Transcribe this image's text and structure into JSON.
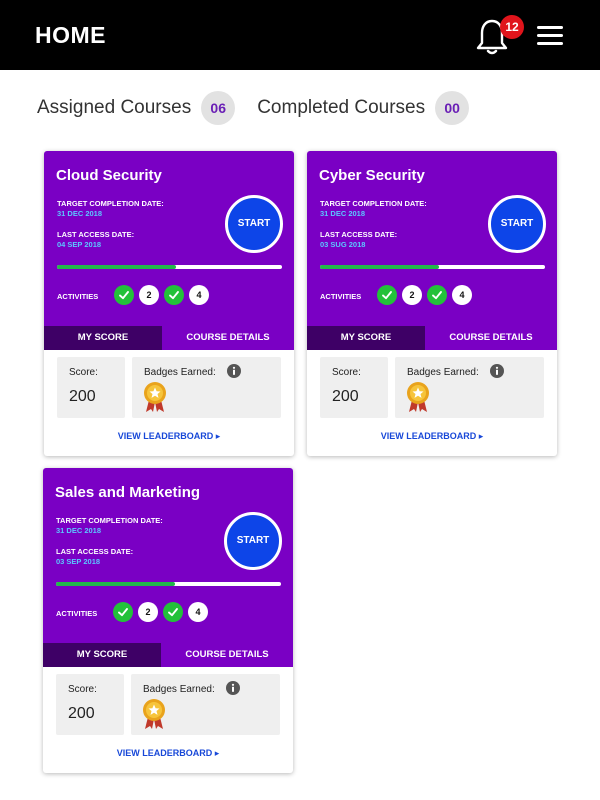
{
  "header": {
    "title": "HOME",
    "notification_count": "12"
  },
  "summary": {
    "assigned_label": "Assigned Courses",
    "assigned_count": "06",
    "completed_label": "Completed Courses",
    "completed_count": "00"
  },
  "labels": {
    "target_label": "TARGET COMPLETION DATE:",
    "access_label": "LAST ACCESS DATE:",
    "start": "START",
    "activities": "ACTIVITIES",
    "tab_score": "MY SCORE",
    "tab_details": "COURSE DETAILS",
    "score": "Score:",
    "badges": "Badges Earned:",
    "leaderboard": "VIEW LEADERBOARD ▸"
  },
  "courses": [
    {
      "title": "Cloud Security",
      "target_date": "31 DEC 2018",
      "last_access": "04 SEP 2018",
      "progress": 0.53,
      "activities": [
        "done",
        "2",
        "done",
        "4"
      ],
      "score": "200"
    },
    {
      "title": "Cyber Security",
      "target_date": "31 DEC 2018",
      "last_access": "03 SUG 2018",
      "progress": 0.53,
      "activities": [
        "done",
        "2",
        "done",
        "4"
      ],
      "score": "200"
    },
    {
      "title": "Sales and Marketing",
      "target_date": "31 DEC 2018",
      "last_access": "03 SEP 2018",
      "progress": 0.53,
      "activities": [
        "done",
        "2",
        "done",
        "4"
      ],
      "score": "200"
    }
  ],
  "colors": {
    "header": "#000000",
    "card": "#7a00c4",
    "tab_active": "#3e0066",
    "start": "#0d45e8",
    "progress": "#23b74a",
    "date_value": "#5cc6ff",
    "badge": "#e0141b",
    "link": "#1848d8"
  },
  "icons": {
    "notification": "bell-icon",
    "menu": "hamburger-menu-icon",
    "done": "check-icon",
    "info": "info-icon",
    "badge": "medal-icon"
  }
}
